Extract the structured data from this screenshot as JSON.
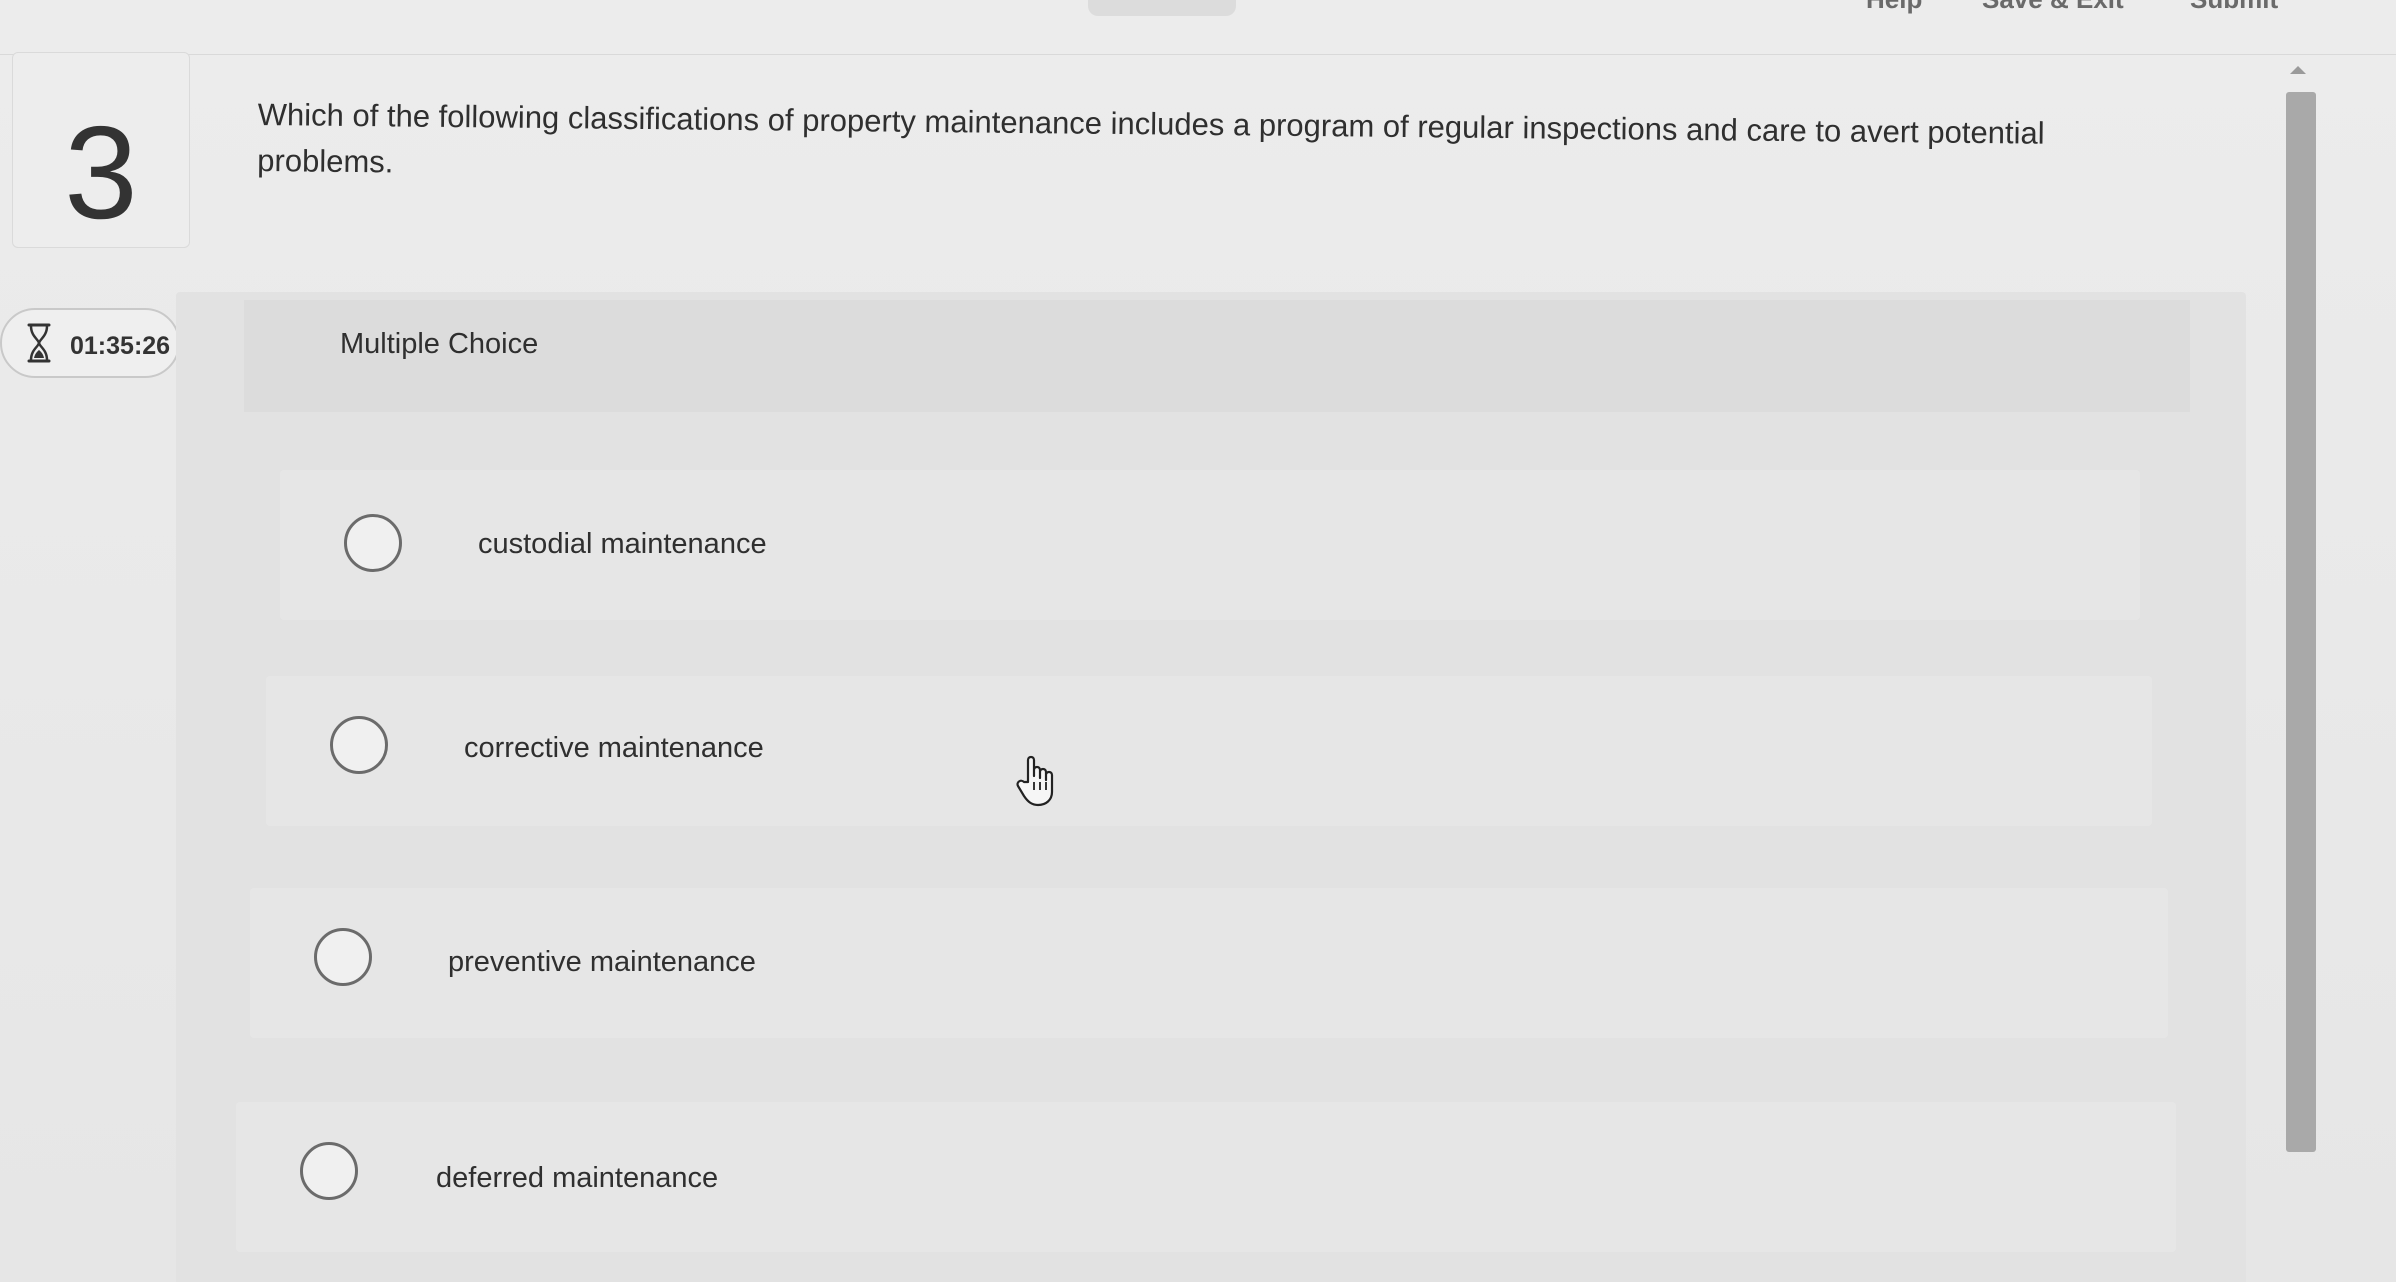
{
  "top_bar": {
    "help_label": "Help",
    "save_exit_label": "Save & Exit",
    "submit_label": "Submit"
  },
  "question": {
    "number": "3",
    "text": "Which of the following classifications of property maintenance includes a program of regular inspections and care to avert potential problems."
  },
  "timer": {
    "icon": "hourglass-icon",
    "value": "01:35:26"
  },
  "answer_section": {
    "type_label": "Multiple Choice",
    "options": [
      {
        "label": "custodial maintenance",
        "selected": false
      },
      {
        "label": "corrective maintenance",
        "selected": false
      },
      {
        "label": "preventive maintenance",
        "selected": false
      },
      {
        "label": "deferred maintenance",
        "selected": false
      }
    ]
  }
}
